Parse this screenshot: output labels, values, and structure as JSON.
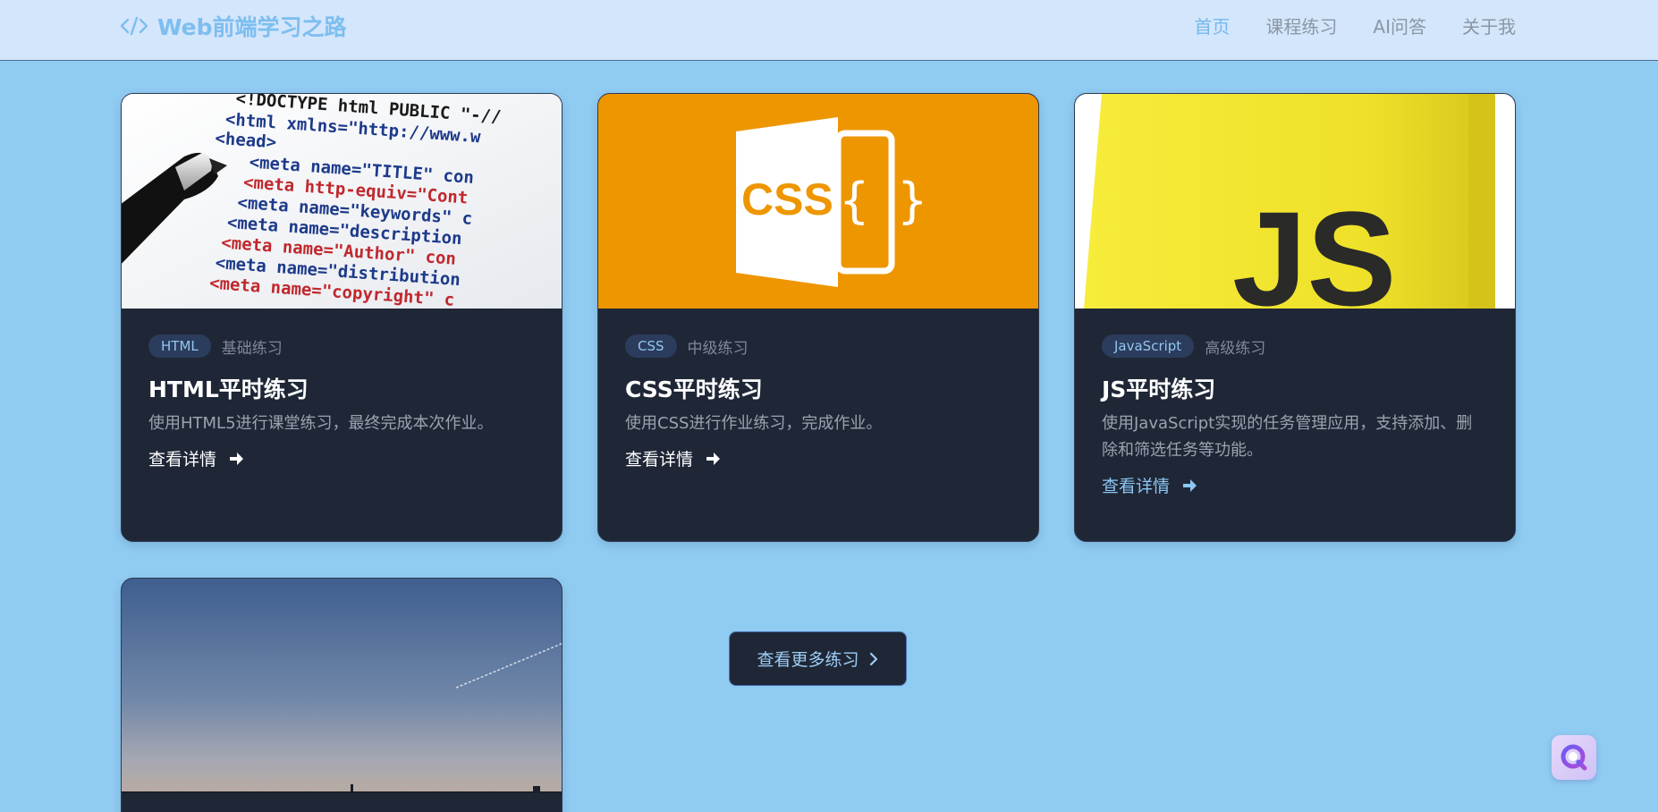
{
  "header": {
    "brand": "Web前端学习之路",
    "nav": [
      {
        "label": "首页",
        "active": true
      },
      {
        "label": "课程练习",
        "active": false
      },
      {
        "label": "AI问答",
        "active": false
      },
      {
        "label": "关于我",
        "active": false
      }
    ]
  },
  "cards": [
    {
      "image": "html-code-photo",
      "image_code_lines": [
        "<!DOCTYPE html PUBLIC \"-//",
        "<html xmlns=\"http://www.w",
        "<head>",
        "<meta name=\"TITLE\" con",
        "<meta http-equiv=\"Cont",
        "<meta name=\"keywords\" c",
        "<meta name=\"description",
        "<meta name=\"Author\" con",
        "<meta name=\"distribution",
        "<meta name=\"copyright\" c"
      ],
      "tag": "HTML",
      "level": "基础练习",
      "title": "HTML平时练习",
      "desc": "使用HTML5进行课堂练习，最终完成本次作业。",
      "link": "查看详情"
    },
    {
      "image": "css-logo",
      "image_text": "CSS",
      "tag": "CSS",
      "level": "中级练习",
      "title": "CSS平时练习",
      "desc": "使用CSS进行作业练习，完成作业。",
      "link": "查看详情"
    },
    {
      "image": "js-logo",
      "image_text": "JS",
      "tag": "JavaScript",
      "level": "高级练习",
      "title": "JS平时练习",
      "desc": "使用JavaScript实现的任务管理应用，支持添加、删除和筛选任务等功能。",
      "link": "查看详情"
    },
    {
      "image": "evening-sky-photo"
    }
  ],
  "more_button": "查看更多练习",
  "colors": {
    "page_bg": "#90cbf2",
    "navbar_bg": "#d4e6fb",
    "card_bg": "#1f2737",
    "accent": "#74b8ec",
    "css_orange": "#ee9600",
    "js_yellow": "#f2e62a"
  }
}
